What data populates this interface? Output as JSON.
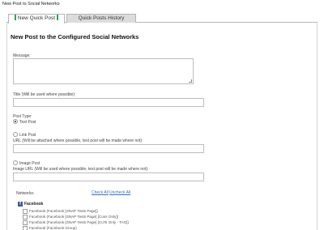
{
  "window": {
    "title": "New Post to Social Networks"
  },
  "tabs": [
    {
      "label": "New Quick Post"
    },
    {
      "label": "Quick Posts History"
    }
  ],
  "form": {
    "heading": "New Post to the Configured Social Networks",
    "message_label": "Message:",
    "title_label": "Title (Will be used where possible):",
    "post_type_label": "Post Type:",
    "post_types": [
      {
        "label": "Text Post",
        "selected": true
      },
      {
        "label": "Link Post",
        "selected": false
      },
      {
        "label": "Image Post",
        "selected": false
      }
    ],
    "url_label": "URL (Will be attached where possible, text post will be made where not):",
    "image_url_label": "Image URL (Will be used where possible, text post will be made where not):",
    "networks_label": "Networks:",
    "check_all": "Check All",
    "uncheck_all": "Uncheck All",
    "facebook": {
      "icon": "facebook-icon",
      "title": "Facebook",
      "accounts": [
        "Facebook (Facebook [SNAP Tests Page])",
        "Facebook (Facebook [SNAP Tests Page] [Cons Only])",
        "Facebook (Facebook [SNAP Tests Page] [CuTs Only - TAG])",
        "Facebook (Facebook Group)"
      ]
    }
  },
  "colors": {
    "tab_indicator": "#2ea44f",
    "link": "#3b6fb6",
    "facebook": "#3b5998"
  }
}
